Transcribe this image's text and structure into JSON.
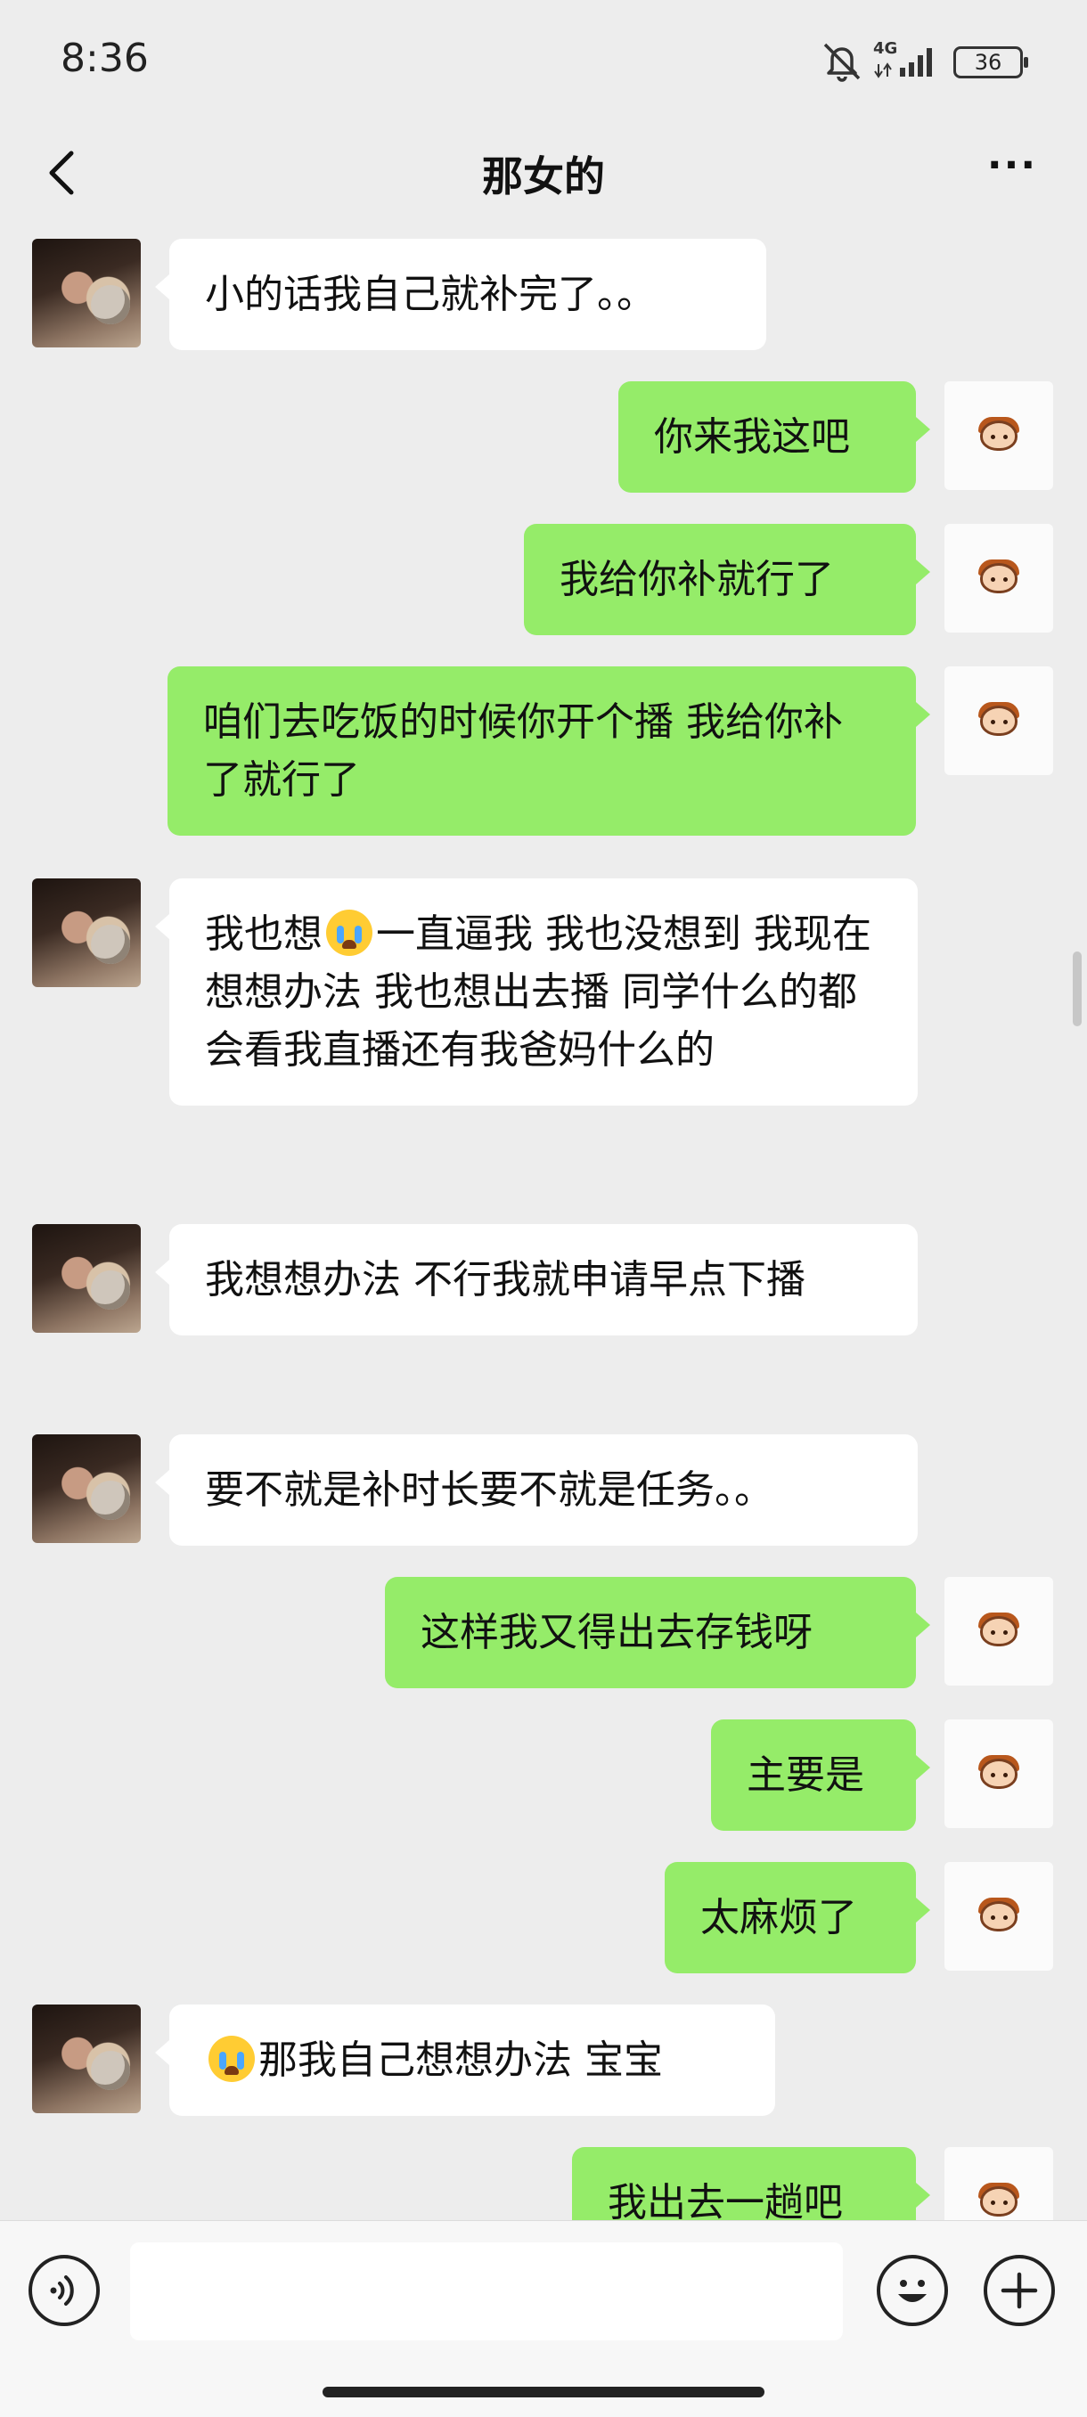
{
  "status_bar": {
    "time": "8:36",
    "network": "4G",
    "battery": "36"
  },
  "header": {
    "title": "那女的",
    "more": "···"
  },
  "messages": [
    {
      "side": "left",
      "text": "小的话我自己就补完了。。"
    },
    {
      "side": "right",
      "text": "你来我这吧"
    },
    {
      "side": "right",
      "text": "我给你补就行了"
    },
    {
      "side": "right",
      "text": "咱们去吃饭的时候你开个播  我给你补了就行了"
    },
    {
      "side": "left",
      "emoji_before": "我也想",
      "emoji": "loudly-crying-face",
      "text": "一直逼我 我也没想到 我现在想想办法 我也想出去播 同学什么的都会看我直播还有我爸妈什么的"
    },
    {
      "side": "left",
      "text": "我想想办法 不行我就申请早点下播"
    },
    {
      "side": "left",
      "text": "要不就是补时长要不就是任务。。"
    },
    {
      "side": "right",
      "text": "这样我又得出去存钱呀"
    },
    {
      "side": "right",
      "text": "主要是"
    },
    {
      "side": "right",
      "text": "太麻烦了"
    },
    {
      "side": "left",
      "emoji": "loudly-crying-face",
      "text": "那我自己想想办法 宝宝"
    },
    {
      "side": "right",
      "text": "我出去一趟吧"
    }
  ],
  "input": {
    "placeholder": ""
  },
  "accent_color": "#95ec69"
}
